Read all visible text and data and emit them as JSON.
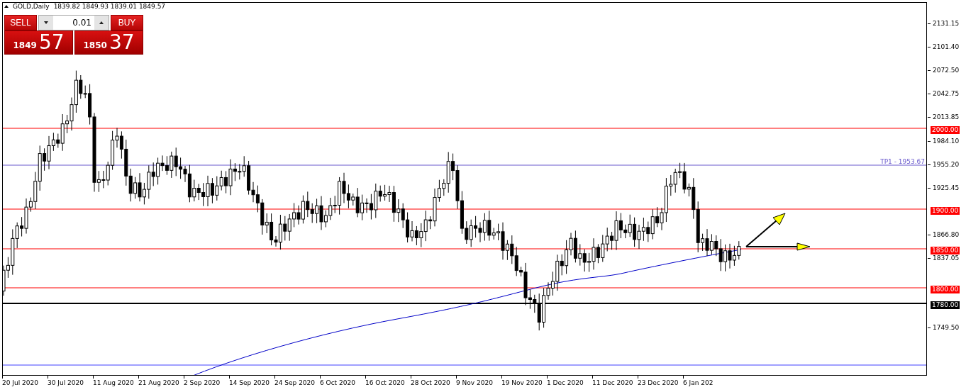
{
  "chart_header": {
    "symbol": "GOLD,Daily",
    "ohlc": "1839.82 1849.93 1839.01 1849.57"
  },
  "trade_panel": {
    "sell_label": "SELL",
    "lot": "0.01",
    "buy_label": "BUY",
    "sell_price_major": "1849",
    "sell_price_minor": "57",
    "buy_price_major": "1850",
    "buy_price_minor": "37"
  },
  "price_axis": {
    "ticks": [
      "2131.15",
      "2101.40",
      "2072.50",
      "2042.75",
      "2013.85",
      "1984.10",
      "1955.20",
      "1925.45",
      "1866.80",
      "1837.05",
      "1749.50"
    ]
  },
  "price_lines": [
    {
      "kind": "level",
      "label": "2000.00",
      "color": "#ff0000"
    },
    {
      "kind": "target",
      "label": "TP1 - 1953.67",
      "color": "#6a5acd"
    },
    {
      "kind": "level",
      "label": "1900.00",
      "color": "#ff0000"
    },
    {
      "kind": "level",
      "label": "1850.00",
      "color": "#ff0000"
    },
    {
      "kind": "level",
      "label": "1800.00",
      "color": "#ff0000"
    },
    {
      "kind": "level",
      "label": "1780.00",
      "color": "#000000"
    }
  ],
  "time_axis": {
    "labels": [
      "20 Jul 2020",
      "30 Jul 2020",
      "11 Aug 2020",
      "21 Aug 2020",
      "2 Sep 2020",
      "14 Sep 2020",
      "24 Sep 2020",
      "6 Oct 2020",
      "16 Oct 2020",
      "28 Oct 2020",
      "9 Nov 2020",
      "19 Nov 2020",
      "1 Dec 2020",
      "11 Dec 2020",
      "23 Dec 2020",
      "6 Jan 202"
    ]
  }
}
